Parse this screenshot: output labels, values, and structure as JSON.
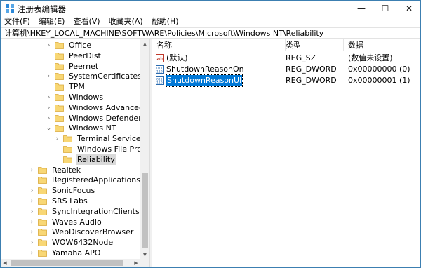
{
  "window": {
    "title": "注册表编辑器",
    "minimize": "—",
    "maximize": "☐",
    "close": "✕"
  },
  "menu": [
    "文件(F)",
    "编辑(E)",
    "查看(V)",
    "收藏夹(A)",
    "帮助(H)"
  ],
  "address": "计算机\\HKEY_LOCAL_MACHINE\\SOFTWARE\\Policies\\Microsoft\\Windows NT\\Reliability",
  "tree": [
    {
      "label": "Office",
      "level": 1,
      "expander": "›",
      "selected": false
    },
    {
      "label": "PeerDist",
      "level": 1,
      "expander": "",
      "selected": false
    },
    {
      "label": "Peernet",
      "level": 1,
      "expander": "",
      "selected": false
    },
    {
      "label": "SystemCertificates",
      "level": 1,
      "expander": "›",
      "selected": false
    },
    {
      "label": "TPM",
      "level": 1,
      "expander": "",
      "selected": false
    },
    {
      "label": "Windows",
      "level": 1,
      "expander": "›",
      "selected": false
    },
    {
      "label": "Windows Advanced Threa",
      "level": 1,
      "expander": "›",
      "selected": false
    },
    {
      "label": "Windows Defender",
      "level": 1,
      "expander": "›",
      "selected": false
    },
    {
      "label": "Windows NT",
      "level": 1,
      "expander": "⌄",
      "selected": false
    },
    {
      "label": "Terminal Services",
      "level": 2,
      "expander": "›",
      "selected": false
    },
    {
      "label": "Windows File Protectic",
      "level": 2,
      "expander": "",
      "selected": false
    },
    {
      "label": "Reliability",
      "level": 2,
      "expander": "",
      "selected": true
    },
    {
      "label": "Realtek",
      "level": 0,
      "expander": "›",
      "selected": false
    },
    {
      "label": "RegisteredApplications",
      "level": 0,
      "expander": "",
      "selected": false
    },
    {
      "label": "SonicFocus",
      "level": 0,
      "expander": "›",
      "selected": false
    },
    {
      "label": "SRS Labs",
      "level": 0,
      "expander": "›",
      "selected": false
    },
    {
      "label": "SyncIntegrationClients",
      "level": 0,
      "expander": "›",
      "selected": false
    },
    {
      "label": "Waves Audio",
      "level": 0,
      "expander": "›",
      "selected": false
    },
    {
      "label": "WebDiscoverBrowser",
      "level": 0,
      "expander": "›",
      "selected": false
    },
    {
      "label": "WOW6432Node",
      "level": 0,
      "expander": "›",
      "selected": false
    },
    {
      "label": "Yamaha APO",
      "level": 0,
      "expander": "›",
      "selected": false
    }
  ],
  "columns": {
    "name": "名称",
    "type": "类型",
    "data": "数据"
  },
  "values": [
    {
      "icon": "string-value-icon",
      "name": "(默认)",
      "type": "REG_SZ",
      "data": "(数值未设置)",
      "selected": false
    },
    {
      "icon": "dword-value-icon",
      "name": "ShutdownReasonOn",
      "type": "REG_DWORD",
      "data": "0x00000000 (0)",
      "selected": false
    },
    {
      "icon": "dword-value-icon",
      "name": "ShutdownReasonUI",
      "type": "REG_DWORD",
      "data": "0x00000001 (1)",
      "selected": true
    }
  ],
  "colors": {
    "folder": "#f8d775",
    "selection": "#0078d7",
    "tree_selection": "#d9d9d9"
  }
}
